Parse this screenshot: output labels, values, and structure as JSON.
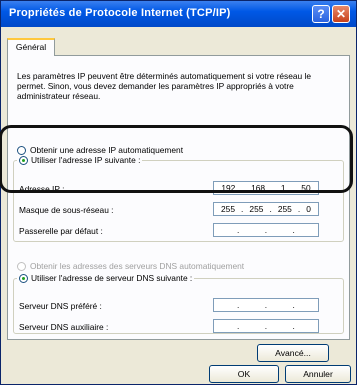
{
  "window": {
    "title": "Propriétés de Protocole Internet (TCP/IP)"
  },
  "titlebar": {
    "help_glyph": "?",
    "close_glyph": "✕"
  },
  "tab": {
    "label": "Général"
  },
  "description": "Les paramètres IP peuvent être déterminés automatiquement si votre réseau le permet. Sinon, vous devez demander les paramètres IP appropriés à votre administrateur réseau.",
  "ip_section": {
    "auto_label": "Obtenir une adresse IP automatiquement",
    "manual_label": "Utiliser l'adresse IP suivante :",
    "selected": "manual",
    "fields": [
      {
        "label": "Adresse IP :",
        "octets": [
          "192",
          "168",
          "1",
          "50"
        ]
      },
      {
        "label": "Masque de sous-réseau :",
        "octets": [
          "255",
          "255",
          "255",
          "0"
        ]
      },
      {
        "label": "Passerelle par défaut :",
        "octets": [
          "",
          "",
          "",
          ""
        ]
      }
    ]
  },
  "dns_section": {
    "auto_label": "Obtenir les adresses des serveurs DNS automatiquement",
    "manual_label": "Utiliser l'adresse de serveur DNS suivante :",
    "selected": "manual",
    "fields": [
      {
        "label": "Serveur DNS préféré :",
        "octets": [
          "",
          "",
          "",
          ""
        ]
      },
      {
        "label": "Serveur DNS auxiliaire :",
        "octets": [
          "",
          "",
          "",
          ""
        ]
      }
    ]
  },
  "buttons": {
    "advanced": "Avancé...",
    "ok": "OK",
    "cancel": "Annuler"
  },
  "colors": {
    "titlebar": "#0058e6",
    "dialog_bg": "#ece9d8",
    "highlight_border": "#111111",
    "radio_dot": "#21a121"
  }
}
